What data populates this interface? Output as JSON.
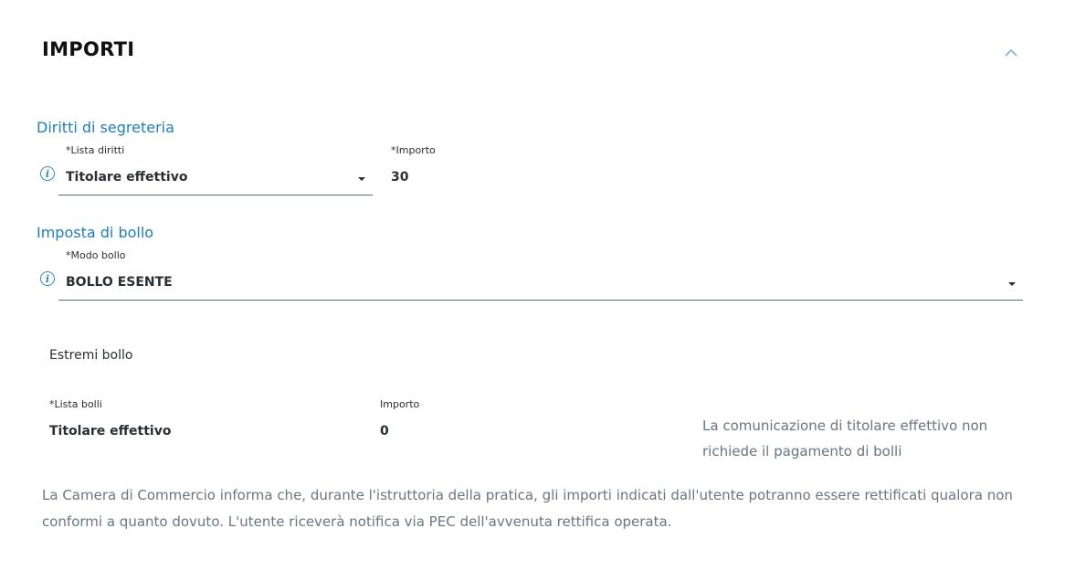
{
  "section": {
    "title": "IMPORTI"
  },
  "diritti": {
    "title": "Diritti di segreteria",
    "lista_label": "*Lista diritti",
    "lista_value": "Titolare effettivo",
    "importo_label": "*Importo",
    "importo_value": "30"
  },
  "bollo": {
    "title": "Imposta di bollo",
    "modo_label": "*Modo bollo",
    "modo_value": "BOLLO ESENTE"
  },
  "estremi": {
    "title": "Estremi bollo",
    "lista_label": "*Lista bolli",
    "lista_value": "Titolare effettivo",
    "importo_label": "Importo",
    "importo_value": "0",
    "note_line1": "La comunicazione di titolare effettivo non",
    "note_line2": "richiede il pagamento di bolli"
  },
  "footer": {
    "line1": "La Camera di Commercio informa che, durante l'istruttoria della pratica, gli importi indicati dall'utente potranno essere rettificati qualora non",
    "line2": "conformi a quanto dovuto. L'utente riceverà notifica via PEC dell'avvenuta rettifica operata."
  },
  "icons": {
    "collapse": "chevron-up-icon",
    "info": "info-icon",
    "dropdown": "caret-down-icon"
  },
  "colors": {
    "accent": "#1f7db8",
    "text": "#2a2f33",
    "muted": "#6b757e"
  }
}
